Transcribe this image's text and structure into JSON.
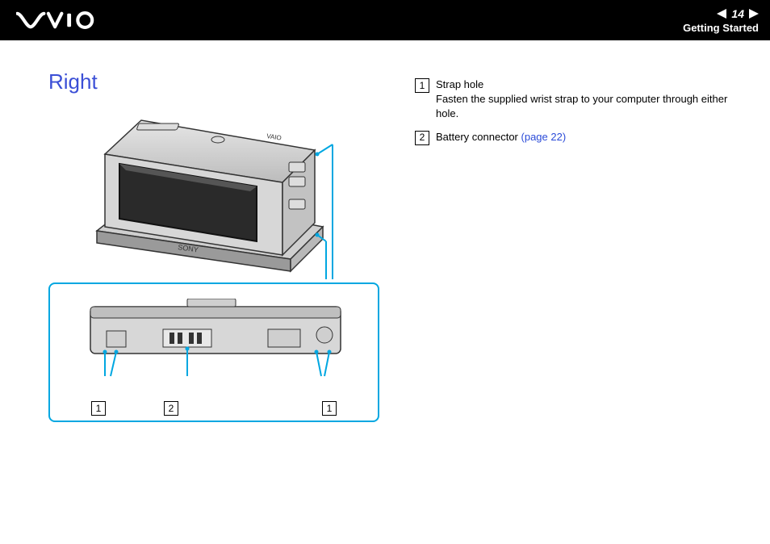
{
  "header": {
    "logo_alt": "VAIO",
    "page_number": "14",
    "section": "Getting Started"
  },
  "page": {
    "title": "Right"
  },
  "callouts": {
    "bottom_left": "1",
    "bottom_mid": "2",
    "bottom_right": "1"
  },
  "items": [
    {
      "num": "1",
      "label": "Strap hole",
      "desc": "Fasten the supplied wrist strap to your computer through either hole."
    },
    {
      "num": "2",
      "label": "Battery connector",
      "link": "(page 22)"
    }
  ]
}
